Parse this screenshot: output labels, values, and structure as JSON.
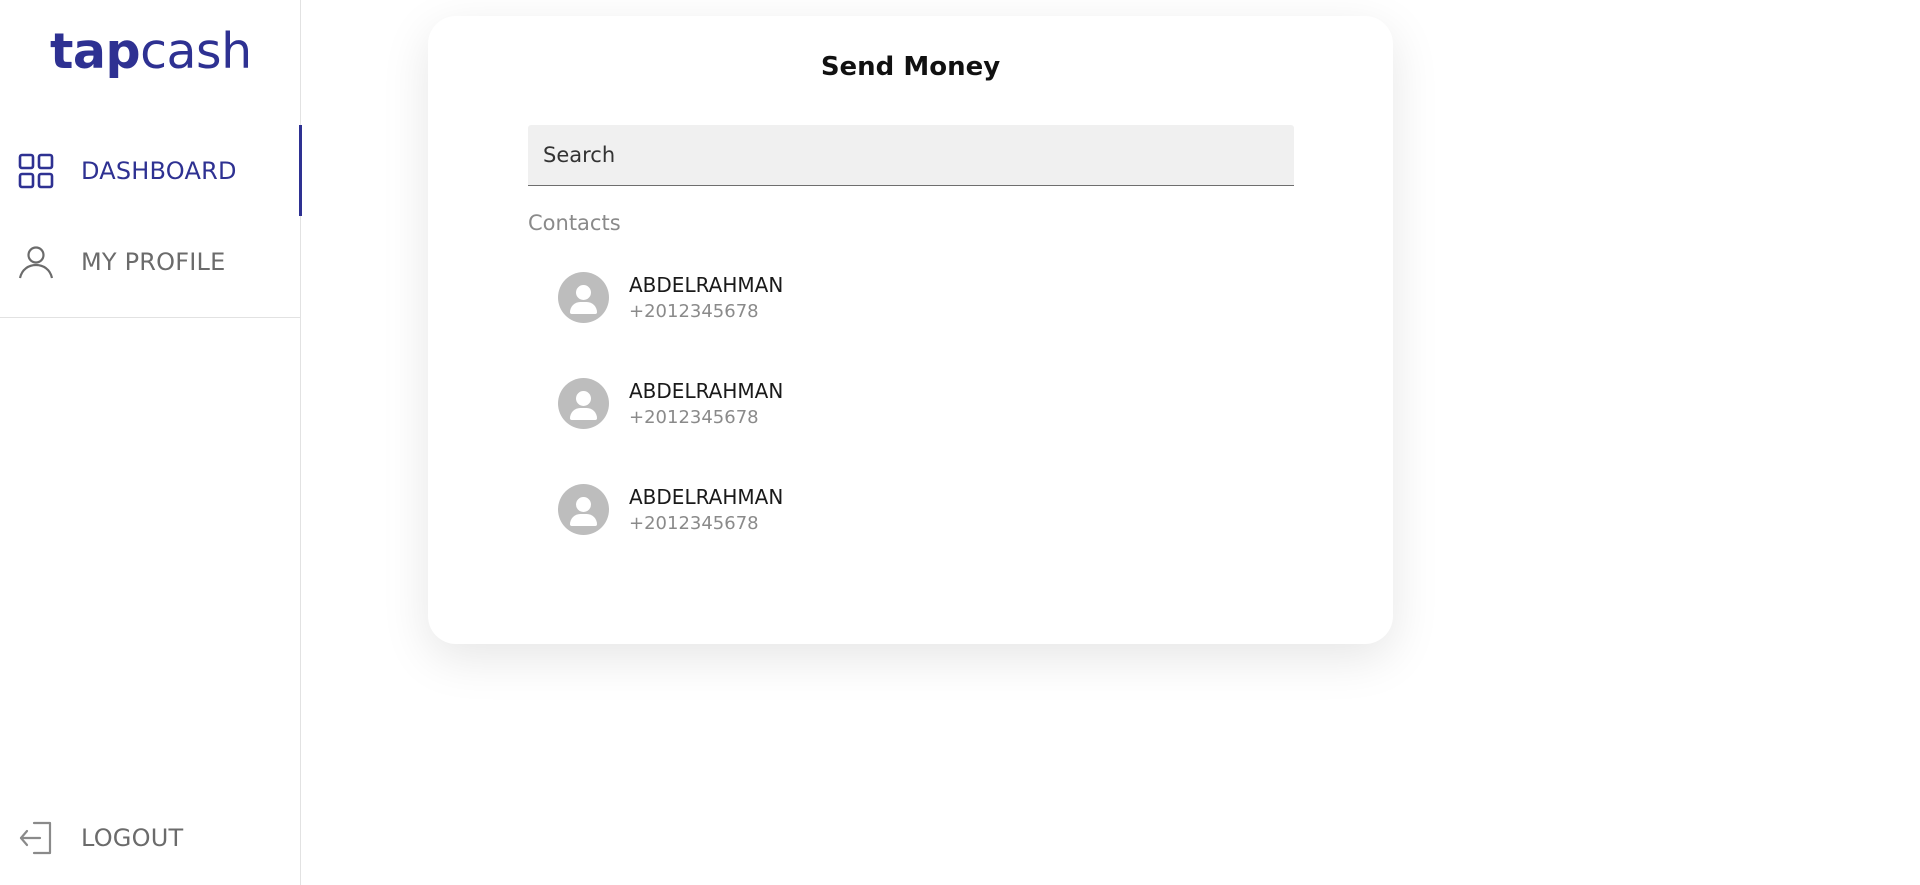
{
  "brand": {
    "logo_part1": "tap",
    "logo_part2": "cash",
    "color": "#2e3192"
  },
  "sidebar": {
    "items": [
      {
        "label": "DASHBOARD",
        "icon": "grid-icon",
        "active": true
      },
      {
        "label": "MY PROFILE",
        "icon": "user-icon",
        "active": false
      }
    ],
    "logout": {
      "label": "LOGOUT",
      "icon": "logout-icon"
    }
  },
  "send_money": {
    "title": "Send Money",
    "search_placeholder": "Search",
    "contacts_label": "Contacts",
    "contacts": [
      {
        "name": "ABDELRAHMAN",
        "phone": "+2012345678"
      },
      {
        "name": "ABDELRAHMAN",
        "phone": "+2012345678"
      },
      {
        "name": "ABDELRAHMAN",
        "phone": "+2012345678"
      }
    ]
  }
}
